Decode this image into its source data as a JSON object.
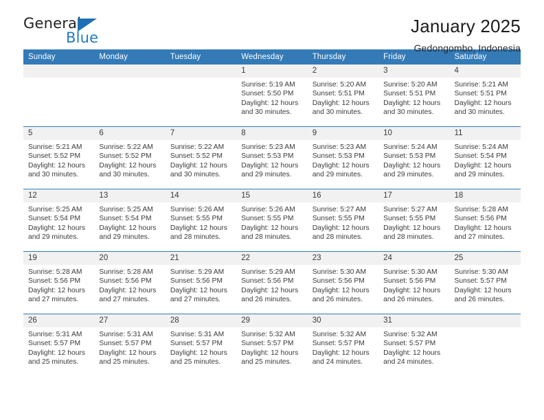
{
  "brand": {
    "name_top": "General",
    "name_bottom": "Blue",
    "triangle_icon": "triangle-icon",
    "color_dark": "#231f20",
    "color_blue": "#1f7ac4"
  },
  "header": {
    "title": "January 2025",
    "location": "Gedongombo, Indonesia"
  },
  "theme": {
    "header_row_bg": "#337ab7",
    "date_band_bg": "#f1f1f1",
    "week_divider": "#337ab7"
  },
  "weekdays": [
    "Sunday",
    "Monday",
    "Tuesday",
    "Wednesday",
    "Thursday",
    "Friday",
    "Saturday"
  ],
  "weeks": [
    [
      {
        "date": "",
        "lines": []
      },
      {
        "date": "",
        "lines": []
      },
      {
        "date": "",
        "lines": []
      },
      {
        "date": "1",
        "lines": [
          "Sunrise: 5:19 AM",
          "Sunset: 5:50 PM",
          "Daylight: 12 hours",
          "and 30 minutes."
        ]
      },
      {
        "date": "2",
        "lines": [
          "Sunrise: 5:20 AM",
          "Sunset: 5:51 PM",
          "Daylight: 12 hours",
          "and 30 minutes."
        ]
      },
      {
        "date": "3",
        "lines": [
          "Sunrise: 5:20 AM",
          "Sunset: 5:51 PM",
          "Daylight: 12 hours",
          "and 30 minutes."
        ]
      },
      {
        "date": "4",
        "lines": [
          "Sunrise: 5:21 AM",
          "Sunset: 5:51 PM",
          "Daylight: 12 hours",
          "and 30 minutes."
        ]
      }
    ],
    [
      {
        "date": "5",
        "lines": [
          "Sunrise: 5:21 AM",
          "Sunset: 5:52 PM",
          "Daylight: 12 hours",
          "and 30 minutes."
        ]
      },
      {
        "date": "6",
        "lines": [
          "Sunrise: 5:22 AM",
          "Sunset: 5:52 PM",
          "Daylight: 12 hours",
          "and 30 minutes."
        ]
      },
      {
        "date": "7",
        "lines": [
          "Sunrise: 5:22 AM",
          "Sunset: 5:52 PM",
          "Daylight: 12 hours",
          "and 30 minutes."
        ]
      },
      {
        "date": "8",
        "lines": [
          "Sunrise: 5:23 AM",
          "Sunset: 5:53 PM",
          "Daylight: 12 hours",
          "and 29 minutes."
        ]
      },
      {
        "date": "9",
        "lines": [
          "Sunrise: 5:23 AM",
          "Sunset: 5:53 PM",
          "Daylight: 12 hours",
          "and 29 minutes."
        ]
      },
      {
        "date": "10",
        "lines": [
          "Sunrise: 5:24 AM",
          "Sunset: 5:53 PM",
          "Daylight: 12 hours",
          "and 29 minutes."
        ]
      },
      {
        "date": "11",
        "lines": [
          "Sunrise: 5:24 AM",
          "Sunset: 5:54 PM",
          "Daylight: 12 hours",
          "and 29 minutes."
        ]
      }
    ],
    [
      {
        "date": "12",
        "lines": [
          "Sunrise: 5:25 AM",
          "Sunset: 5:54 PM",
          "Daylight: 12 hours",
          "and 29 minutes."
        ]
      },
      {
        "date": "13",
        "lines": [
          "Sunrise: 5:25 AM",
          "Sunset: 5:54 PM",
          "Daylight: 12 hours",
          "and 29 minutes."
        ]
      },
      {
        "date": "14",
        "lines": [
          "Sunrise: 5:26 AM",
          "Sunset: 5:55 PM",
          "Daylight: 12 hours",
          "and 28 minutes."
        ]
      },
      {
        "date": "15",
        "lines": [
          "Sunrise: 5:26 AM",
          "Sunset: 5:55 PM",
          "Daylight: 12 hours",
          "and 28 minutes."
        ]
      },
      {
        "date": "16",
        "lines": [
          "Sunrise: 5:27 AM",
          "Sunset: 5:55 PM",
          "Daylight: 12 hours",
          "and 28 minutes."
        ]
      },
      {
        "date": "17",
        "lines": [
          "Sunrise: 5:27 AM",
          "Sunset: 5:55 PM",
          "Daylight: 12 hours",
          "and 28 minutes."
        ]
      },
      {
        "date": "18",
        "lines": [
          "Sunrise: 5:28 AM",
          "Sunset: 5:56 PM",
          "Daylight: 12 hours",
          "and 27 minutes."
        ]
      }
    ],
    [
      {
        "date": "19",
        "lines": [
          "Sunrise: 5:28 AM",
          "Sunset: 5:56 PM",
          "Daylight: 12 hours",
          "and 27 minutes."
        ]
      },
      {
        "date": "20",
        "lines": [
          "Sunrise: 5:28 AM",
          "Sunset: 5:56 PM",
          "Daylight: 12 hours",
          "and 27 minutes."
        ]
      },
      {
        "date": "21",
        "lines": [
          "Sunrise: 5:29 AM",
          "Sunset: 5:56 PM",
          "Daylight: 12 hours",
          "and 27 minutes."
        ]
      },
      {
        "date": "22",
        "lines": [
          "Sunrise: 5:29 AM",
          "Sunset: 5:56 PM",
          "Daylight: 12 hours",
          "and 26 minutes."
        ]
      },
      {
        "date": "23",
        "lines": [
          "Sunrise: 5:30 AM",
          "Sunset: 5:56 PM",
          "Daylight: 12 hours",
          "and 26 minutes."
        ]
      },
      {
        "date": "24",
        "lines": [
          "Sunrise: 5:30 AM",
          "Sunset: 5:56 PM",
          "Daylight: 12 hours",
          "and 26 minutes."
        ]
      },
      {
        "date": "25",
        "lines": [
          "Sunrise: 5:30 AM",
          "Sunset: 5:57 PM",
          "Daylight: 12 hours",
          "and 26 minutes."
        ]
      }
    ],
    [
      {
        "date": "26",
        "lines": [
          "Sunrise: 5:31 AM",
          "Sunset: 5:57 PM",
          "Daylight: 12 hours",
          "and 25 minutes."
        ]
      },
      {
        "date": "27",
        "lines": [
          "Sunrise: 5:31 AM",
          "Sunset: 5:57 PM",
          "Daylight: 12 hours",
          "and 25 minutes."
        ]
      },
      {
        "date": "28",
        "lines": [
          "Sunrise: 5:31 AM",
          "Sunset: 5:57 PM",
          "Daylight: 12 hours",
          "and 25 minutes."
        ]
      },
      {
        "date": "29",
        "lines": [
          "Sunrise: 5:32 AM",
          "Sunset: 5:57 PM",
          "Daylight: 12 hours",
          "and 25 minutes."
        ]
      },
      {
        "date": "30",
        "lines": [
          "Sunrise: 5:32 AM",
          "Sunset: 5:57 PM",
          "Daylight: 12 hours",
          "and 24 minutes."
        ]
      },
      {
        "date": "31",
        "lines": [
          "Sunrise: 5:32 AM",
          "Sunset: 5:57 PM",
          "Daylight: 12 hours",
          "and 24 minutes."
        ]
      },
      {
        "date": "",
        "lines": []
      }
    ]
  ]
}
